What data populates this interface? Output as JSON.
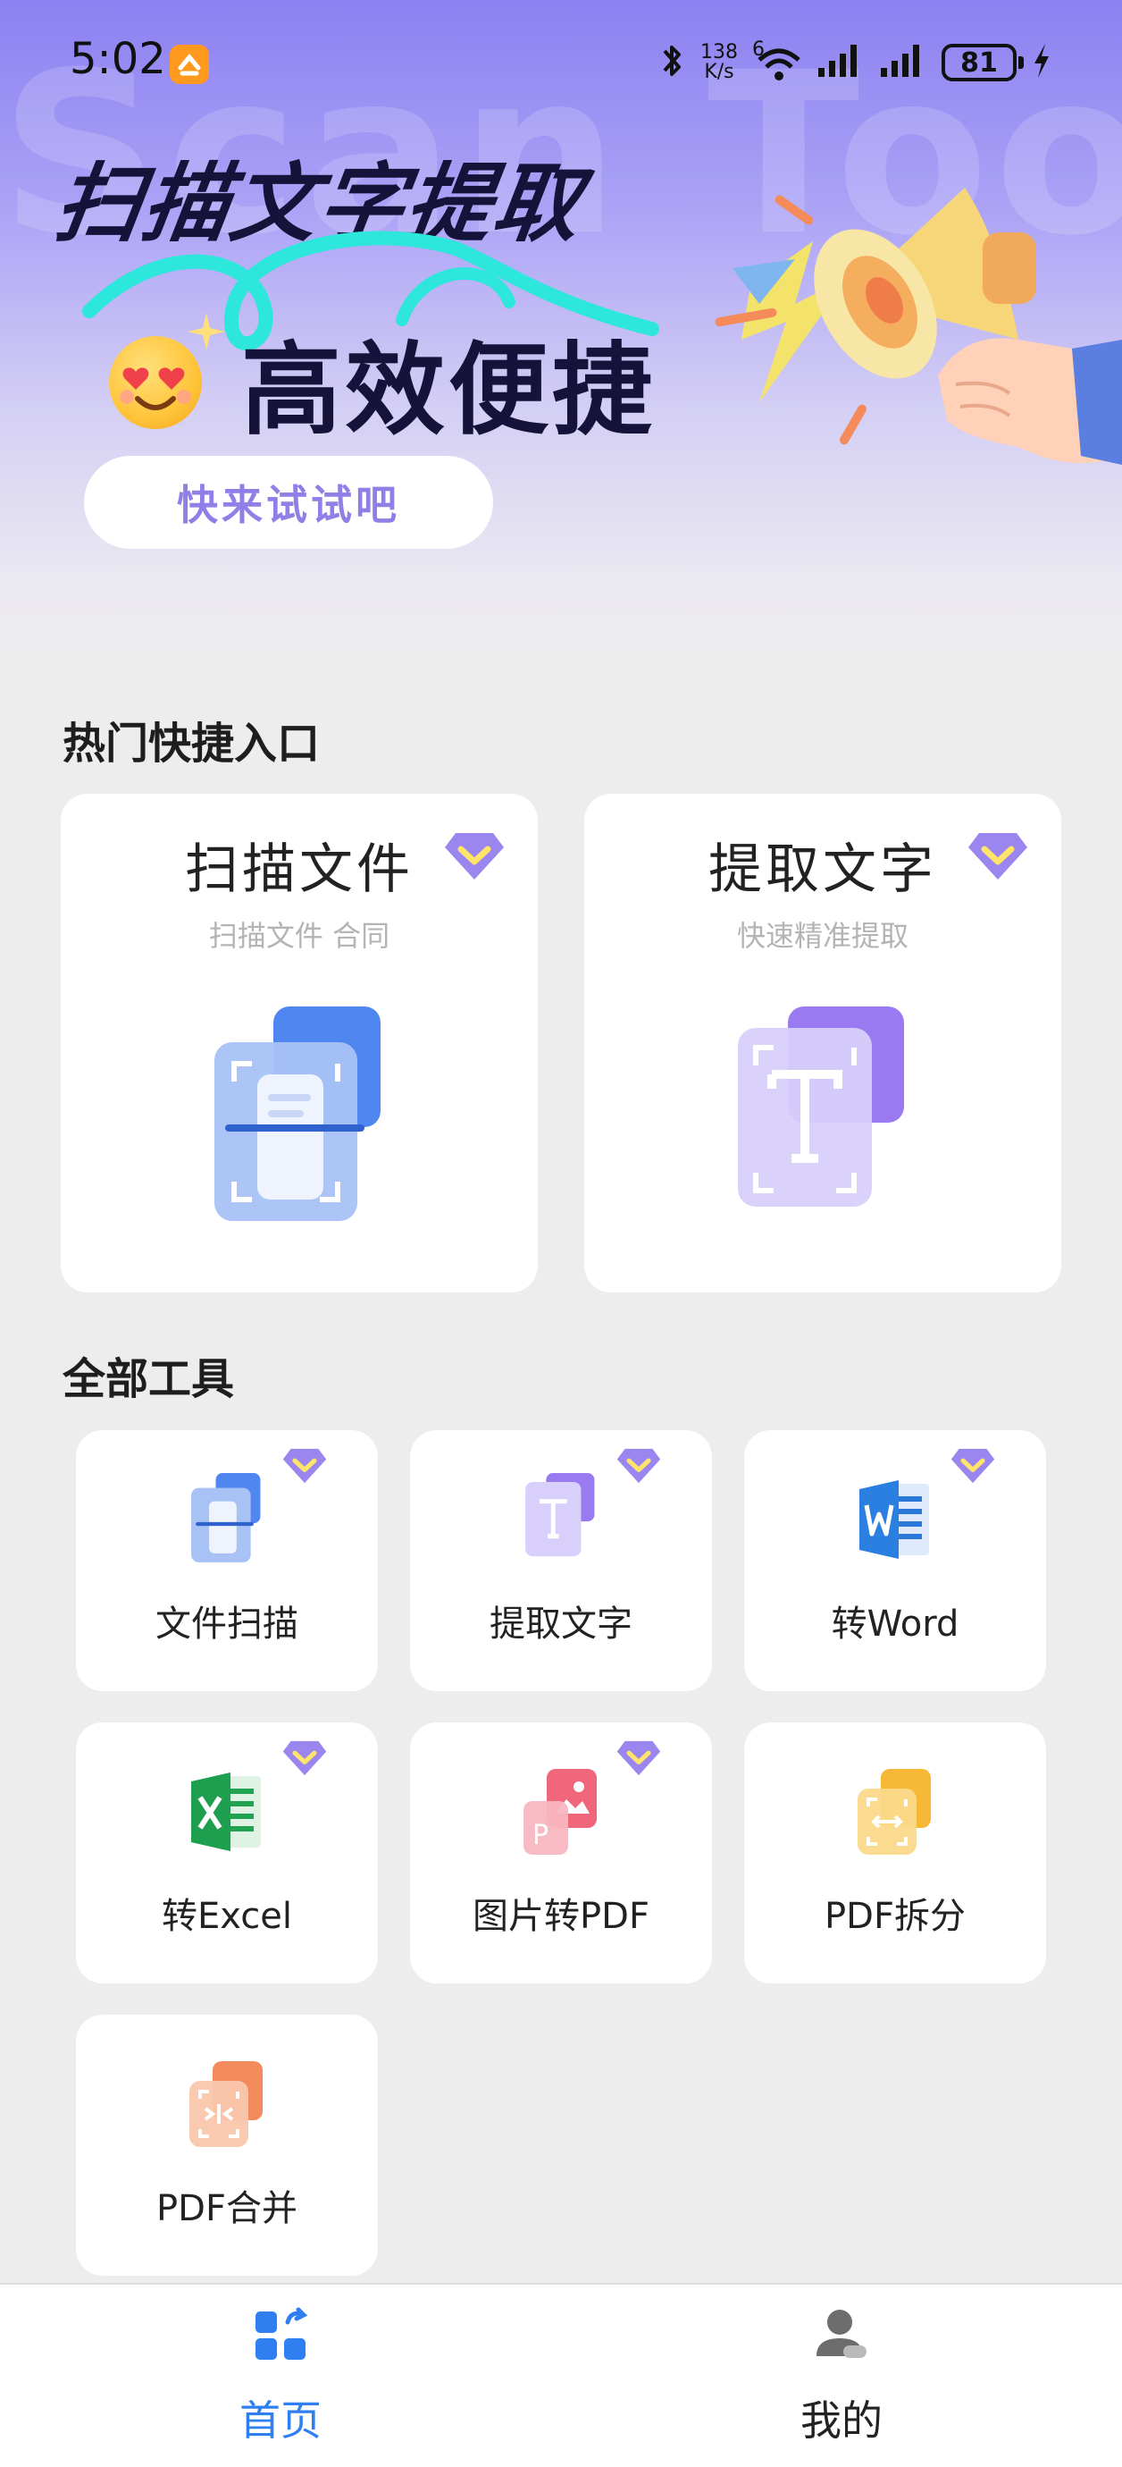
{
  "status_bar": {
    "time": "5:02",
    "net_speed_value": "138",
    "net_speed_unit": "K/s",
    "wifi_label": "6",
    "battery_level": "81"
  },
  "hero": {
    "watermark": "Scan Tool",
    "title": "扫描文字提取",
    "subtitle": "高效便捷",
    "cta_label": "快来试试吧"
  },
  "hot_section": {
    "title": "热门快捷入口",
    "cards": [
      {
        "title": "扫描文件",
        "subtitle": "扫描文件 合同",
        "vip": true,
        "icon": "scan-document-icon"
      },
      {
        "title": "提取文字",
        "subtitle": "快速精准提取",
        "vip": true,
        "icon": "text-extract-icon"
      }
    ]
  },
  "tools_section": {
    "title": "全部工具",
    "tools": [
      {
        "label": "文件扫描",
        "vip": true,
        "icon": "scan-document-icon"
      },
      {
        "label": "提取文字",
        "vip": true,
        "icon": "text-extract-icon"
      },
      {
        "label": "转Word",
        "vip": true,
        "icon": "word-icon"
      },
      {
        "label": "转Excel",
        "vip": true,
        "icon": "excel-icon"
      },
      {
        "label": "图片转PDF",
        "vip": true,
        "icon": "image-to-pdf-icon"
      },
      {
        "label": "PDF拆分",
        "vip": false,
        "icon": "pdf-split-icon"
      },
      {
        "label": "PDF合并",
        "vip": false,
        "icon": "pdf-merge-icon"
      }
    ]
  },
  "bottom_nav": {
    "items": [
      {
        "label": "首页",
        "active": true,
        "icon": "home-grid-icon"
      },
      {
        "label": "我的",
        "active": false,
        "icon": "profile-icon"
      }
    ]
  },
  "colors": {
    "accent": "#8f7fe6",
    "nav_active": "#2f7ff0",
    "nav_inactive": "#222222",
    "vip_badge": "#9a86ee"
  }
}
